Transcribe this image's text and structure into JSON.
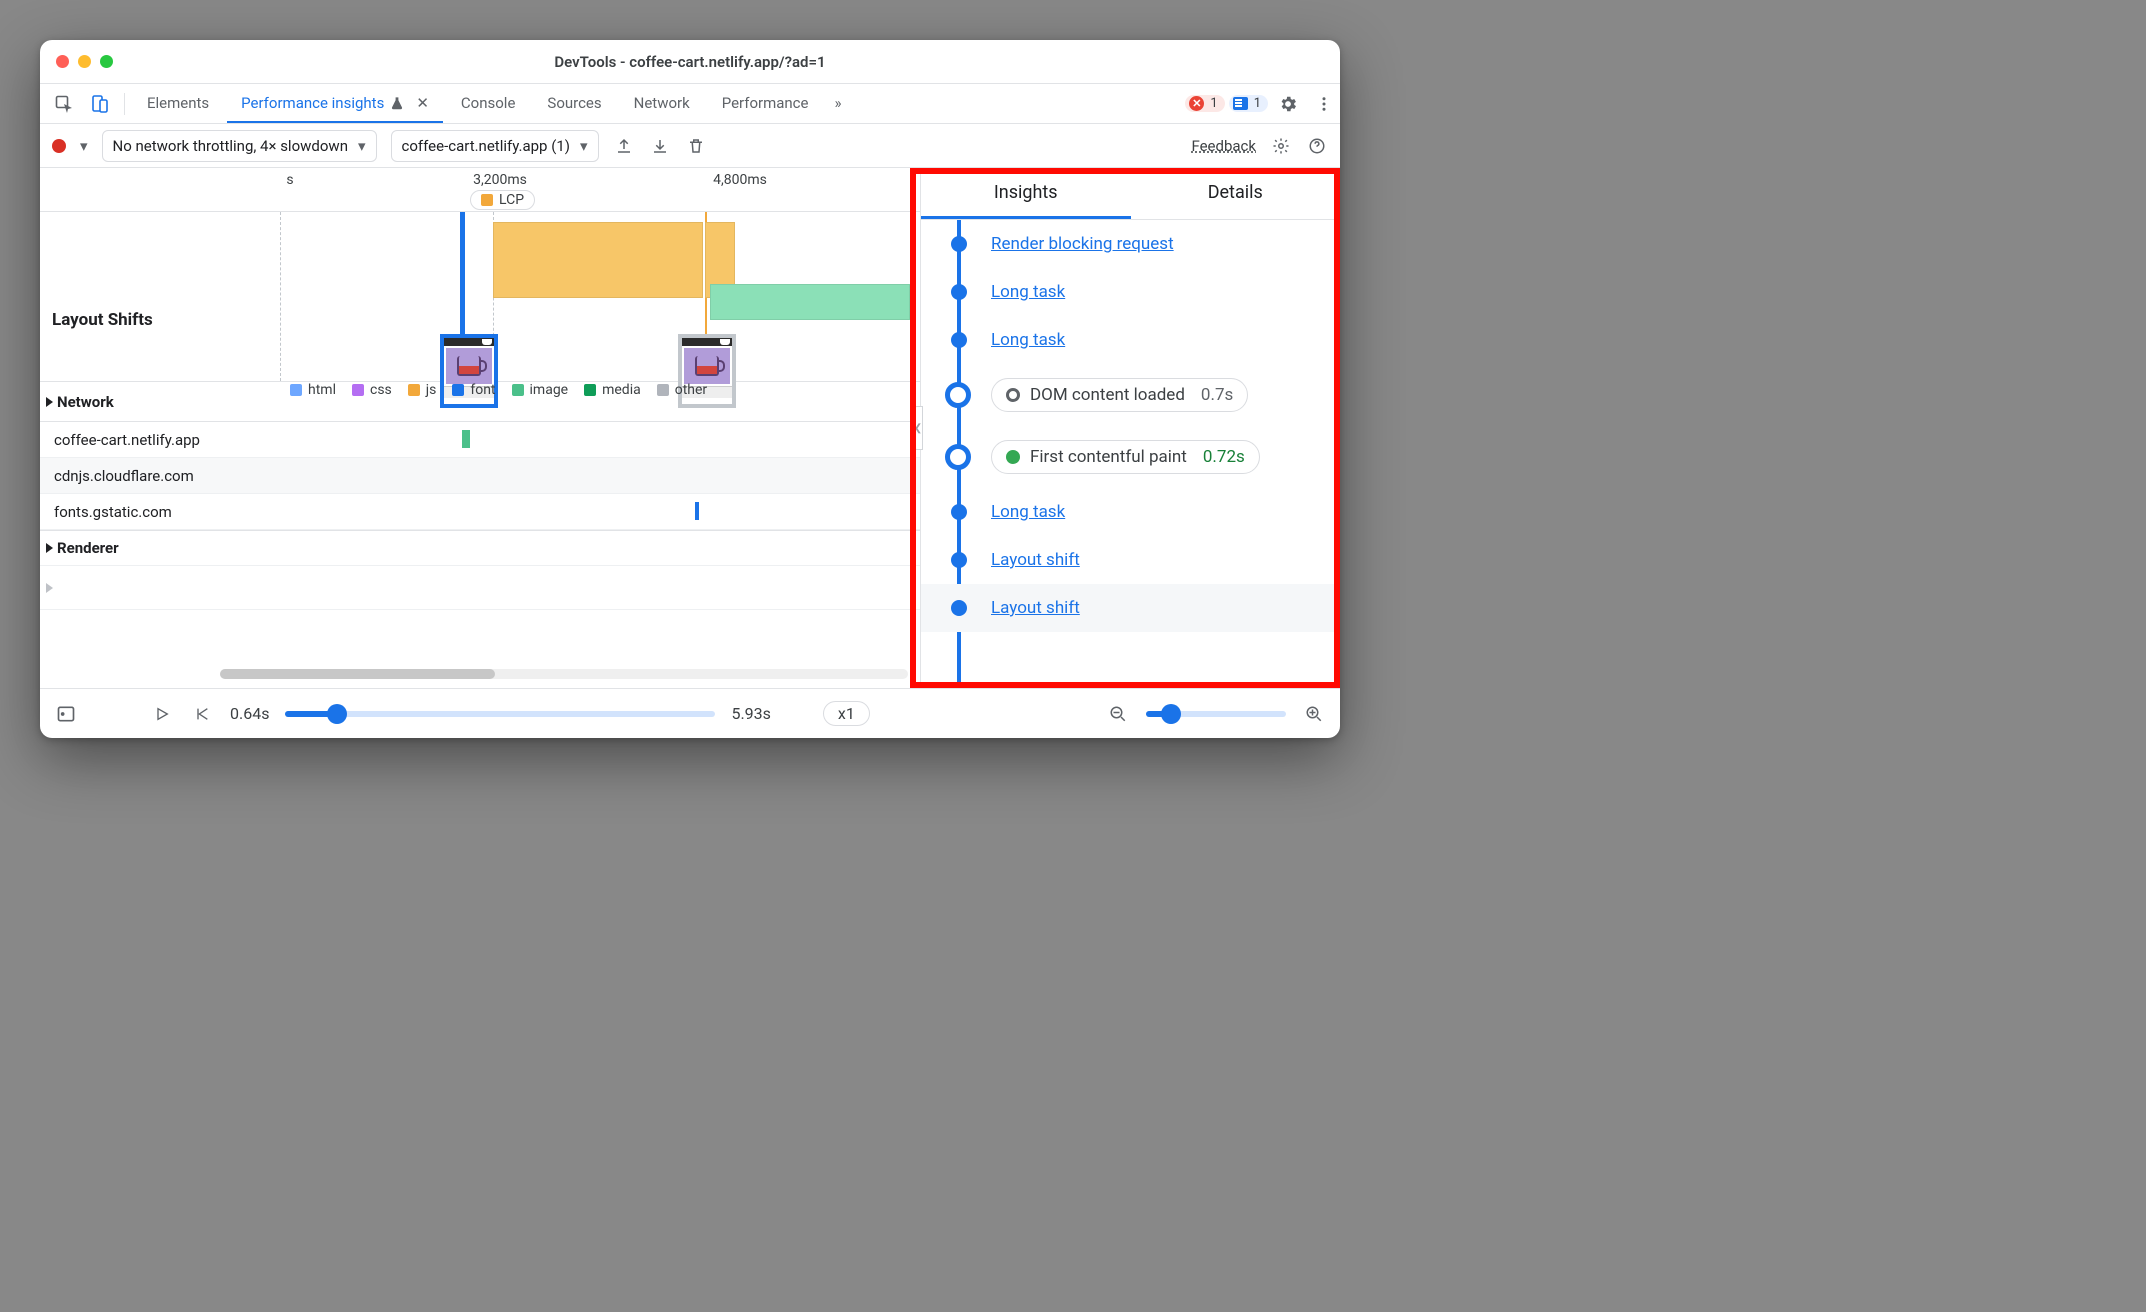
{
  "window": {
    "title": "DevTools - coffee-cart.netlify.app/?ad=1"
  },
  "tabs": {
    "elements": "Elements",
    "perf_insights": "Performance insights ",
    "close_x": "✕",
    "console": "Console",
    "sources": "Sources",
    "network": "Network",
    "performance": "Performance",
    "error_count": "1",
    "issue_count": "1"
  },
  "toolbar": {
    "throttle": "No network throttling, 4× slowdown",
    "recording": "coffee-cart.netlify.app (1)",
    "feedback": "Feedback"
  },
  "timeline": {
    "tick1": "s",
    "tick2": "3,200ms",
    "tick3": "4,800ms",
    "lcp": "LCP",
    "layout_shifts": "Layout Shifts",
    "network": "Network",
    "renderer": "Renderer",
    "hosts": [
      "coffee-cart.netlify.app",
      "cdnjs.cloudflare.com",
      "fonts.gstatic.com"
    ],
    "legend": {
      "html": "html",
      "css": "css",
      "js": "js",
      "font": "font",
      "image": "image",
      "media": "media",
      "other": "other"
    },
    "colors": {
      "html": "#6ea7ff",
      "css": "#b46ef2",
      "js": "#f2a83b",
      "font": "#1a73e8",
      "image": "#4bc08a",
      "media": "#0f9d58",
      "other": "#b0b4bb"
    }
  },
  "insights": {
    "tab_insights": "Insights",
    "tab_details": "Details",
    "items": [
      {
        "kind": "link",
        "text": "Render blocking request"
      },
      {
        "kind": "link",
        "text": "Long task"
      },
      {
        "kind": "link",
        "text": "Long task"
      },
      {
        "kind": "pill",
        "dot": "#9aa0a6",
        "hollow": true,
        "text": "DOM content loaded",
        "time": "0.7s"
      },
      {
        "kind": "pill",
        "dot": "#34a853",
        "text": "First contentful paint",
        "time": "0.72s",
        "green": true
      },
      {
        "kind": "link",
        "text": "Long task"
      },
      {
        "kind": "link",
        "text": "Layout shift"
      },
      {
        "kind": "link",
        "text": "Layout shift"
      }
    ]
  },
  "footer": {
    "start": "0.64s",
    "end": "5.93s",
    "speed": "x1"
  }
}
